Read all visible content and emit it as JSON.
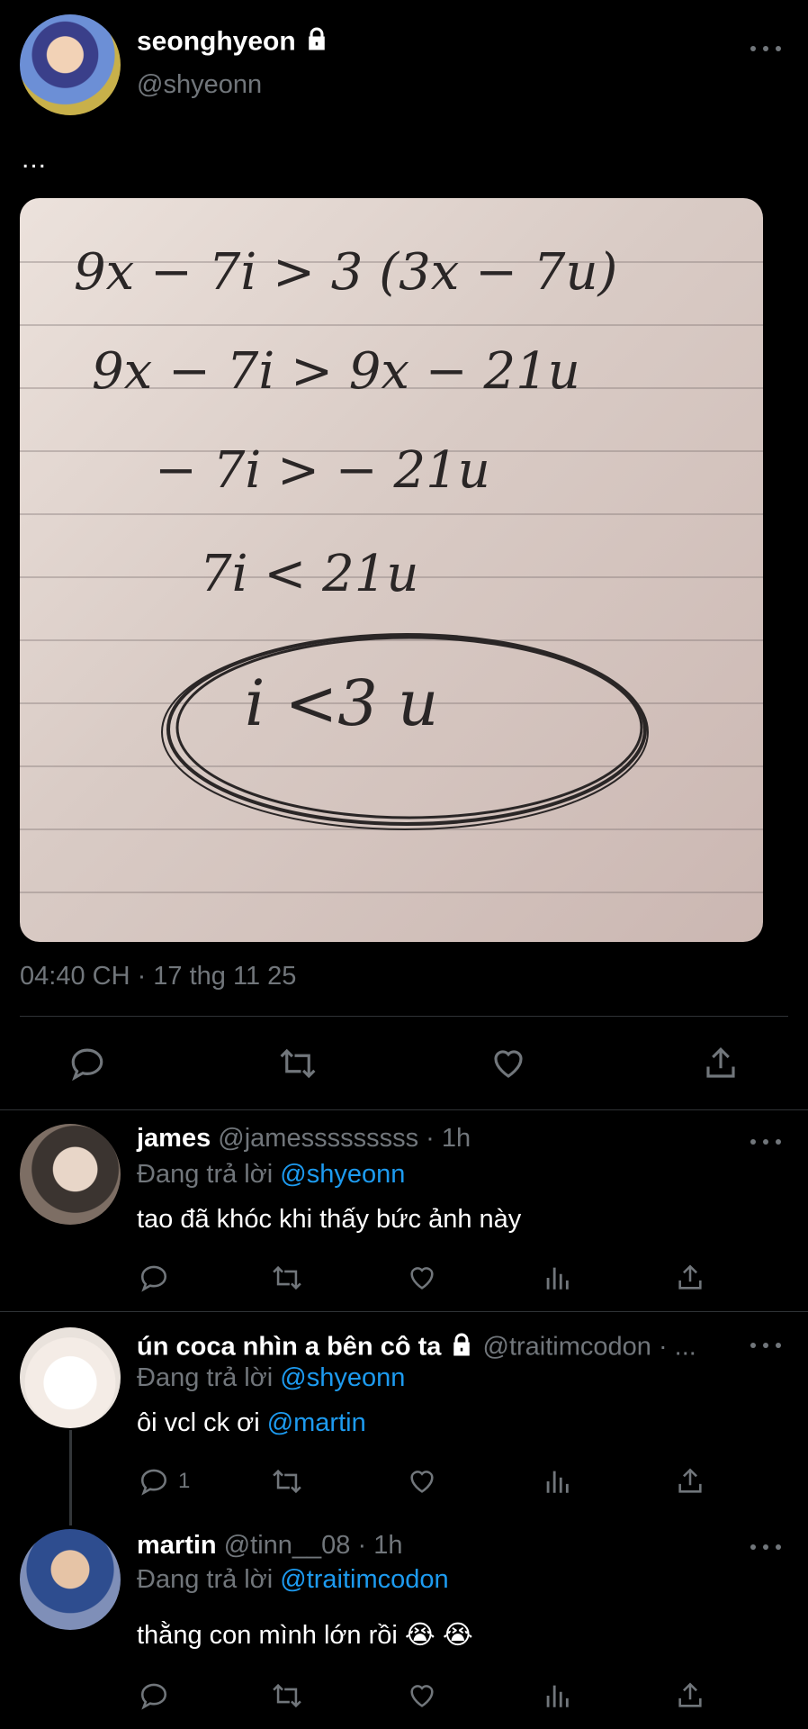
{
  "main_tweet": {
    "display_name": "seonghyeon",
    "handle": "@shyeonn",
    "text": "...",
    "timestamp": "04:40 CH · 17 thg 11 25",
    "photo_lines": [
      "9x − 7i > 3 (3x − 7u)",
      "9x − 7i > 9x − 21u",
      "− 7i > − 21u",
      "7i < 21u",
      "i <3 u"
    ]
  },
  "replies": [
    {
      "display_name": "james",
      "handle": "@jamesssssssss",
      "time": "· 1h",
      "replying_prefix": "Đang trả lời",
      "replying_to": "@shyeonn",
      "text": "tao đã khóc khi thấy bức ảnh này",
      "reply_count": ""
    },
    {
      "display_name": "ún coca nhìn a bên cô ta",
      "handle": "@traitimcodon · ...",
      "time": "",
      "replying_prefix": "Đang trả lời",
      "replying_to": "@shyeonn",
      "text_plain": "ôi vcl ck ơi ",
      "text_mention": "@martin",
      "reply_count": "1"
    },
    {
      "display_name": "martin",
      "handle": "@tinn__08",
      "time": "· 1h",
      "replying_prefix": "Đang trả lời",
      "replying_to": "@traitimcodon",
      "text": "thằng con mình lớn rồi 😭 😭",
      "reply_count": ""
    }
  ],
  "colors": {
    "background": "#000000",
    "muted": "#71767b",
    "link": "#1d9bf0",
    "divider": "#2f3336"
  },
  "icons": [
    "lock-icon",
    "more-icon",
    "reply-icon",
    "retweet-icon",
    "like-icon",
    "share-icon",
    "views-icon"
  ]
}
